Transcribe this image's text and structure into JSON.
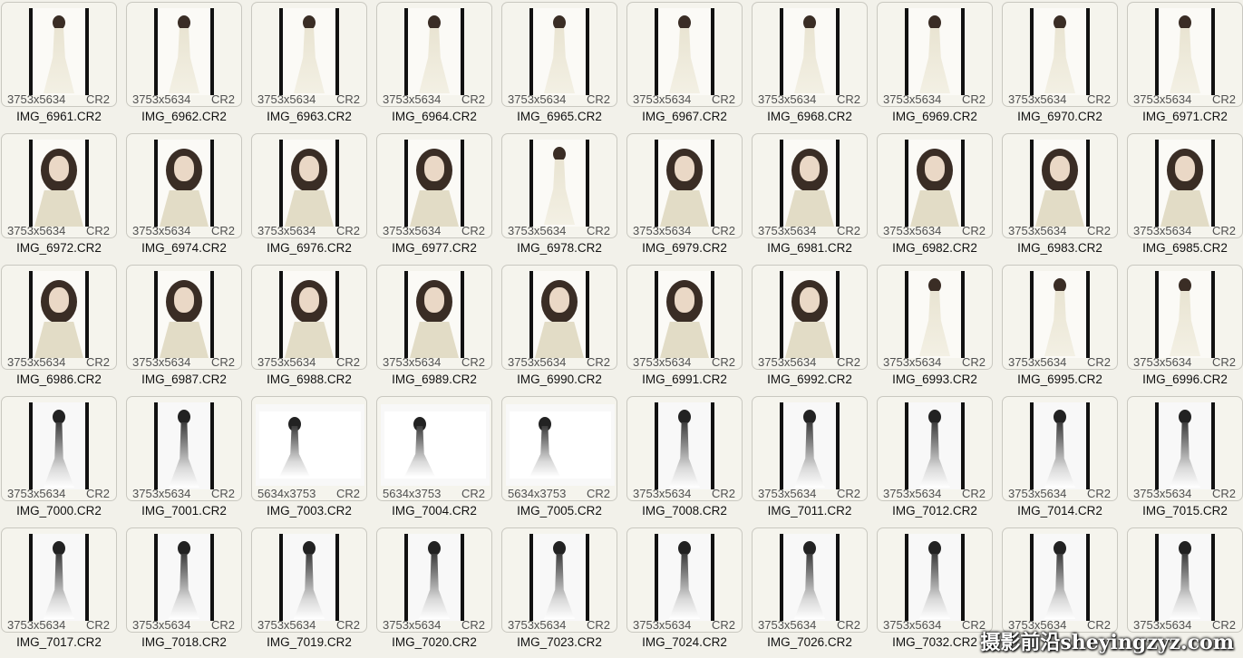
{
  "files": [
    {
      "name": "IMG_6961.CR2",
      "dims": "3753x5634",
      "ext": "CR2",
      "orientation": "portrait",
      "style": "full"
    },
    {
      "name": "IMG_6962.CR2",
      "dims": "3753x5634",
      "ext": "CR2",
      "orientation": "portrait",
      "style": "full"
    },
    {
      "name": "IMG_6963.CR2",
      "dims": "3753x5634",
      "ext": "CR2",
      "orientation": "portrait",
      "style": "full"
    },
    {
      "name": "IMG_6964.CR2",
      "dims": "3753x5634",
      "ext": "CR2",
      "orientation": "portrait",
      "style": "full"
    },
    {
      "name": "IMG_6965.CR2",
      "dims": "3753x5634",
      "ext": "CR2",
      "orientation": "portrait",
      "style": "full"
    },
    {
      "name": "IMG_6967.CR2",
      "dims": "3753x5634",
      "ext": "CR2",
      "orientation": "portrait",
      "style": "full"
    },
    {
      "name": "IMG_6968.CR2",
      "dims": "3753x5634",
      "ext": "CR2",
      "orientation": "portrait",
      "style": "full"
    },
    {
      "name": "IMG_6969.CR2",
      "dims": "3753x5634",
      "ext": "CR2",
      "orientation": "portrait",
      "style": "full"
    },
    {
      "name": "IMG_6970.CR2",
      "dims": "3753x5634",
      "ext": "CR2",
      "orientation": "portrait",
      "style": "full"
    },
    {
      "name": "IMG_6971.CR2",
      "dims": "3753x5634",
      "ext": "CR2",
      "orientation": "portrait",
      "style": "full"
    },
    {
      "name": "IMG_6972.CR2",
      "dims": "3753x5634",
      "ext": "CR2",
      "orientation": "portrait",
      "style": "face"
    },
    {
      "name": "IMG_6974.CR2",
      "dims": "3753x5634",
      "ext": "CR2",
      "orientation": "portrait",
      "style": "face"
    },
    {
      "name": "IMG_6976.CR2",
      "dims": "3753x5634",
      "ext": "CR2",
      "orientation": "portrait",
      "style": "face"
    },
    {
      "name": "IMG_6977.CR2",
      "dims": "3753x5634",
      "ext": "CR2",
      "orientation": "portrait",
      "style": "face"
    },
    {
      "name": "IMG_6978.CR2",
      "dims": "3753x5634",
      "ext": "CR2",
      "orientation": "portrait",
      "style": "full"
    },
    {
      "name": "IMG_6979.CR2",
      "dims": "3753x5634",
      "ext": "CR2",
      "orientation": "portrait",
      "style": "face"
    },
    {
      "name": "IMG_6981.CR2",
      "dims": "3753x5634",
      "ext": "CR2",
      "orientation": "portrait",
      "style": "face"
    },
    {
      "name": "IMG_6982.CR2",
      "dims": "3753x5634",
      "ext": "CR2",
      "orientation": "portrait",
      "style": "face"
    },
    {
      "name": "IMG_6983.CR2",
      "dims": "3753x5634",
      "ext": "CR2",
      "orientation": "portrait",
      "style": "face"
    },
    {
      "name": "IMG_6985.CR2",
      "dims": "3753x5634",
      "ext": "CR2",
      "orientation": "portrait",
      "style": "face"
    },
    {
      "name": "IMG_6986.CR2",
      "dims": "3753x5634",
      "ext": "CR2",
      "orientation": "portrait",
      "style": "face"
    },
    {
      "name": "IMG_6987.CR2",
      "dims": "3753x5634",
      "ext": "CR2",
      "orientation": "portrait",
      "style": "face"
    },
    {
      "name": "IMG_6988.CR2",
      "dims": "3753x5634",
      "ext": "CR2",
      "orientation": "portrait",
      "style": "face"
    },
    {
      "name": "IMG_6989.CR2",
      "dims": "3753x5634",
      "ext": "CR2",
      "orientation": "portrait",
      "style": "face"
    },
    {
      "name": "IMG_6990.CR2",
      "dims": "3753x5634",
      "ext": "CR2",
      "orientation": "portrait",
      "style": "face"
    },
    {
      "name": "IMG_6991.CR2",
      "dims": "3753x5634",
      "ext": "CR2",
      "orientation": "portrait",
      "style": "face"
    },
    {
      "name": "IMG_6992.CR2",
      "dims": "3753x5634",
      "ext": "CR2",
      "orientation": "portrait",
      "style": "face"
    },
    {
      "name": "IMG_6993.CR2",
      "dims": "3753x5634",
      "ext": "CR2",
      "orientation": "portrait",
      "style": "full"
    },
    {
      "name": "IMG_6995.CR2",
      "dims": "3753x5634",
      "ext": "CR2",
      "orientation": "portrait",
      "style": "full"
    },
    {
      "name": "IMG_6996.CR2",
      "dims": "3753x5634",
      "ext": "CR2",
      "orientation": "portrait",
      "style": "full"
    },
    {
      "name": "IMG_7000.CR2",
      "dims": "3753x5634",
      "ext": "CR2",
      "orientation": "portrait",
      "style": "bw"
    },
    {
      "name": "IMG_7001.CR2",
      "dims": "3753x5634",
      "ext": "CR2",
      "orientation": "portrait",
      "style": "bw"
    },
    {
      "name": "IMG_7003.CR2",
      "dims": "5634x3753",
      "ext": "CR2",
      "orientation": "landscape",
      "style": "bw"
    },
    {
      "name": "IMG_7004.CR2",
      "dims": "5634x3753",
      "ext": "CR2",
      "orientation": "landscape",
      "style": "bw"
    },
    {
      "name": "IMG_7005.CR2",
      "dims": "5634x3753",
      "ext": "CR2",
      "orientation": "landscape",
      "style": "bw"
    },
    {
      "name": "IMG_7008.CR2",
      "dims": "3753x5634",
      "ext": "CR2",
      "orientation": "portrait",
      "style": "bw"
    },
    {
      "name": "IMG_7011.CR2",
      "dims": "3753x5634",
      "ext": "CR2",
      "orientation": "portrait",
      "style": "bw"
    },
    {
      "name": "IMG_7012.CR2",
      "dims": "3753x5634",
      "ext": "CR2",
      "orientation": "portrait",
      "style": "bw"
    },
    {
      "name": "IMG_7014.CR2",
      "dims": "3753x5634",
      "ext": "CR2",
      "orientation": "portrait",
      "style": "bw"
    },
    {
      "name": "IMG_7015.CR2",
      "dims": "3753x5634",
      "ext": "CR2",
      "orientation": "portrait",
      "style": "bw"
    },
    {
      "name": "IMG_7017.CR2",
      "dims": "3753x5634",
      "ext": "CR2",
      "orientation": "portrait",
      "style": "bw"
    },
    {
      "name": "IMG_7018.CR2",
      "dims": "3753x5634",
      "ext": "CR2",
      "orientation": "portrait",
      "style": "bw"
    },
    {
      "name": "IMG_7019.CR2",
      "dims": "3753x5634",
      "ext": "CR2",
      "orientation": "portrait",
      "style": "bw"
    },
    {
      "name": "IMG_7020.CR2",
      "dims": "3753x5634",
      "ext": "CR2",
      "orientation": "portrait",
      "style": "bw"
    },
    {
      "name": "IMG_7023.CR2",
      "dims": "3753x5634",
      "ext": "CR2",
      "orientation": "portrait",
      "style": "bw"
    },
    {
      "name": "IMG_7024.CR2",
      "dims": "3753x5634",
      "ext": "CR2",
      "orientation": "portrait",
      "style": "bw"
    },
    {
      "name": "IMG_7026.CR2",
      "dims": "3753x5634",
      "ext": "CR2",
      "orientation": "portrait",
      "style": "bw"
    },
    {
      "name": "IMG_7032.CR2",
      "dims": "3753x5634",
      "ext": "CR2",
      "orientation": "portrait",
      "style": "bw"
    },
    {
      "name": "",
      "dims": "3753x5634",
      "ext": "CR2",
      "orientation": "portrait",
      "style": "bw"
    },
    {
      "name": "",
      "dims": "3753x5634",
      "ext": "CR2",
      "orientation": "portrait",
      "style": "bw"
    }
  ],
  "watermark": "摄影前沿sheyingzyz.com"
}
